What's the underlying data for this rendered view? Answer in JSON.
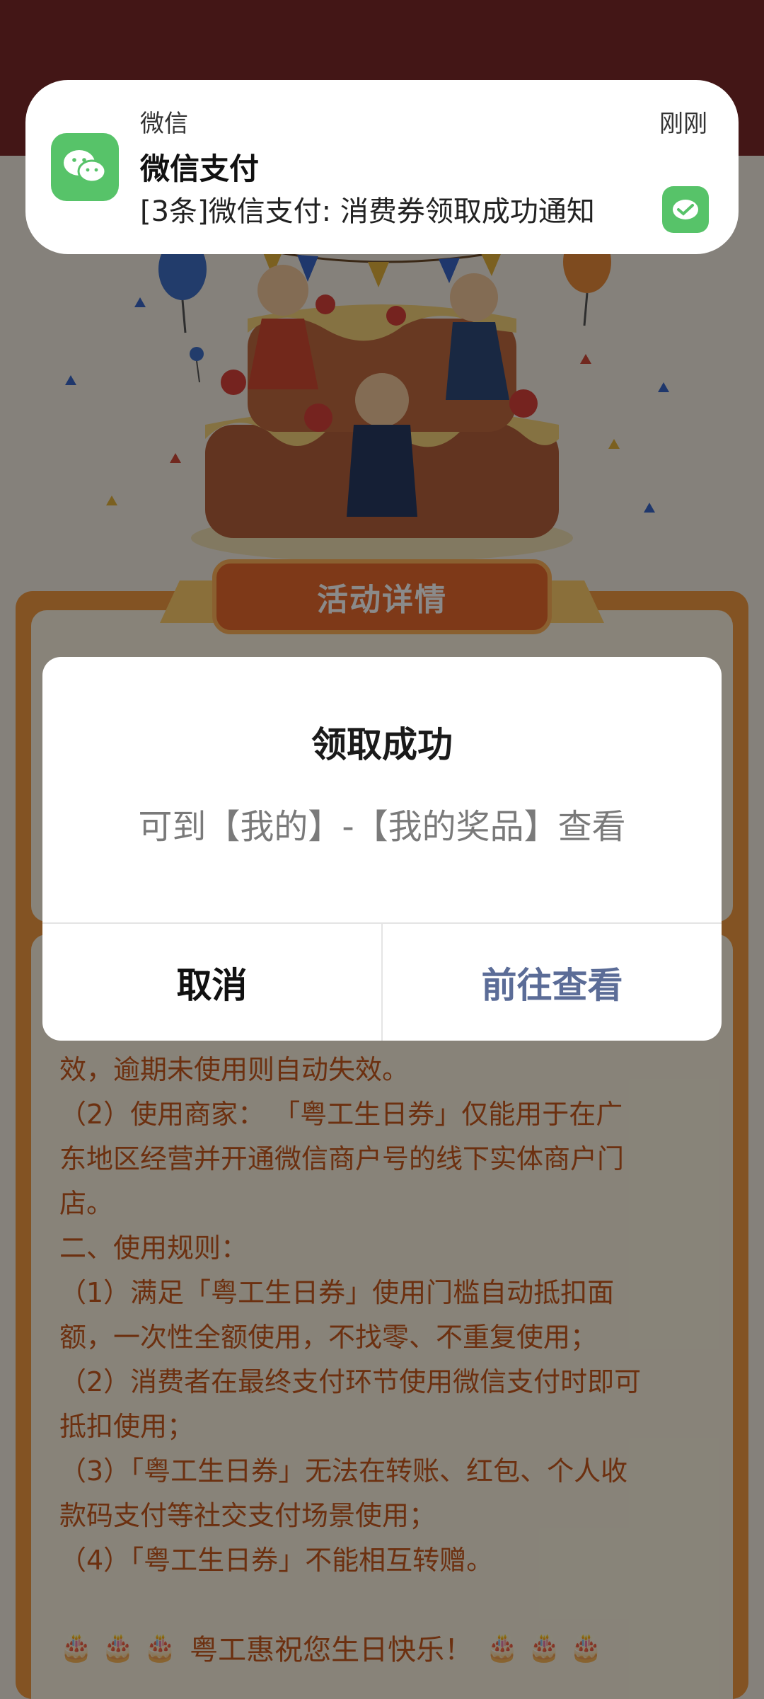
{
  "notification": {
    "app_name": "微信",
    "time": "刚刚",
    "title": "微信支付",
    "body": "[3条]微信支付: 消费券领取成功通知",
    "app_icon": "wechat-icon",
    "right_icon": "wechat-pay-icon"
  },
  "activity": {
    "section_title": "活动详情",
    "rules": [
      "效，逾期未使用则自动失效。",
      "（2）使用商家：  「粤工生日券」仅能用于在广",
      "东地区经营并开通微信商户号的线下实体商户门",
      "店。",
      "二、使用规则：",
      "（1）满足「粤工生日券」使用门槛自动抵扣面",
      "额，一次性全额使用，不找零、不重复使用；",
      "（2）消费者在最终支付环节使用微信支付时即可",
      "抵扣使用；",
      "（3）「粤工生日券」无法在转账、红包、个人收",
      "款码支付等社交支付场景使用；",
      "（4）「粤工生日券」不能相互转赠。"
    ],
    "footer_cakes_left": "🎂 🎂 🎂",
    "footer_wish": "粤工惠祝您生日快乐！",
    "footer_cakes_right": "🎂 🎂 🎂"
  },
  "dialog": {
    "title": "领取成功",
    "message": "可到【我的】-【我的奖品】查看",
    "cancel_label": "取消",
    "confirm_label": "前往查看"
  },
  "colors": {
    "wechat_green": "#57c369",
    "confirm_text": "#5b6c97",
    "rules_text": "#c85a1e",
    "panel_orange": "#f29a42"
  }
}
